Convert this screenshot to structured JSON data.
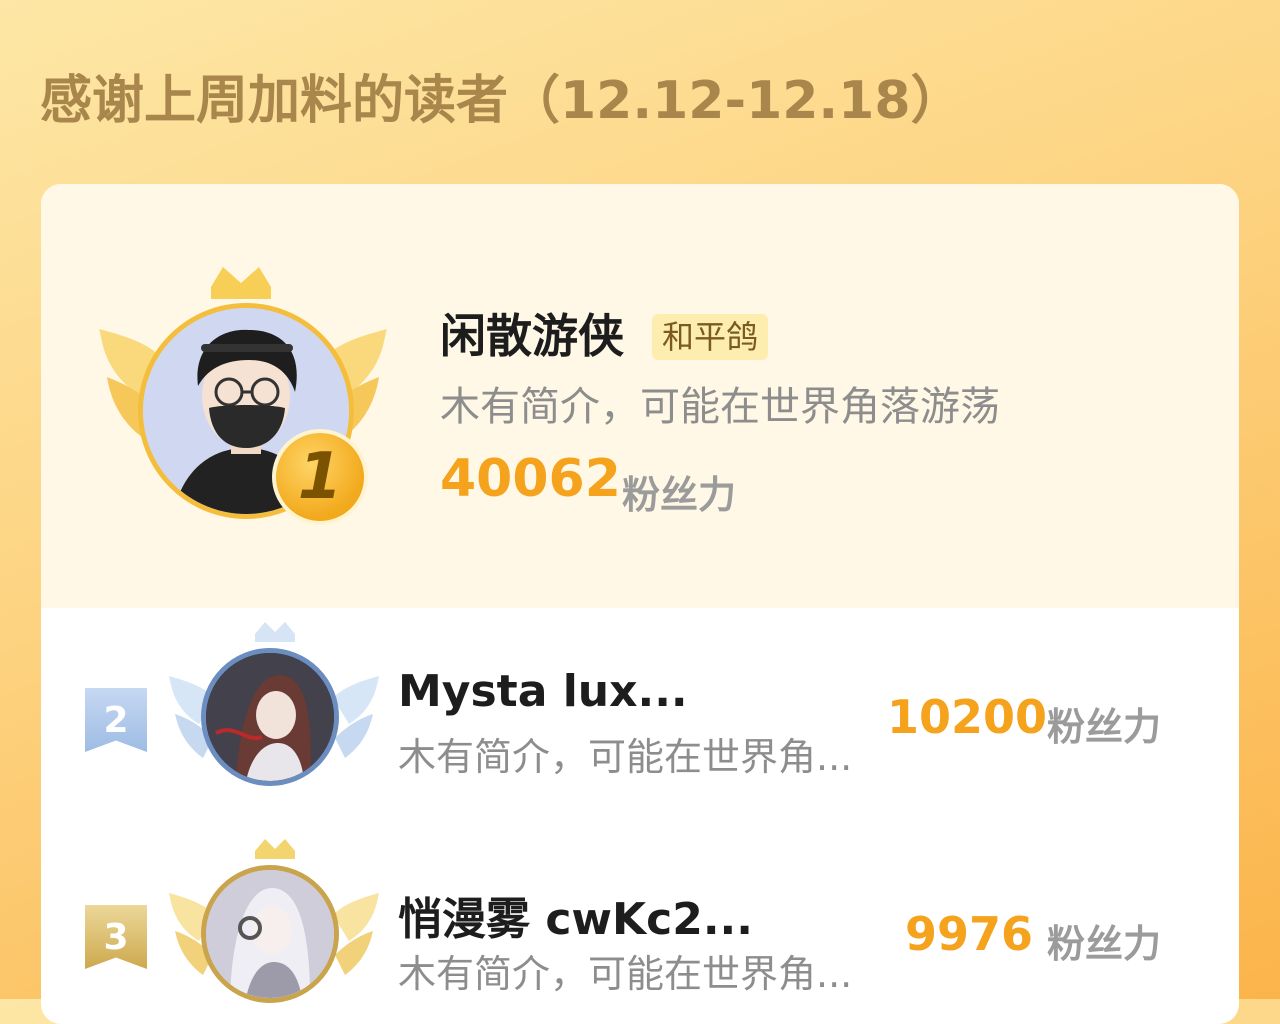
{
  "header": {
    "title": "感谢上周加料的读者（12.12-12.18）"
  },
  "leaderboard": {
    "first": {
      "rank": "1",
      "name": "闲散游侠",
      "badge": "和平鸽",
      "bio": "木有简介，可能在世界角落游荡",
      "score": "40062",
      "score_label": "粉丝力"
    },
    "rows": [
      {
        "rank": "2",
        "name": "Mysta  lux...",
        "bio": "木有简介，可能在世界角...",
        "score": "10200",
        "score_label": "粉丝力"
      },
      {
        "rank": "3",
        "name": "悄漫雾  cwKc2...",
        "bio": "木有简介，可能在世界角...",
        "score": "9976",
        "score_label": "粉丝力"
      }
    ]
  },
  "colors": {
    "accent": "#f5a21c",
    "silver": "#a9c3e6",
    "bronze": "#d8b865"
  }
}
